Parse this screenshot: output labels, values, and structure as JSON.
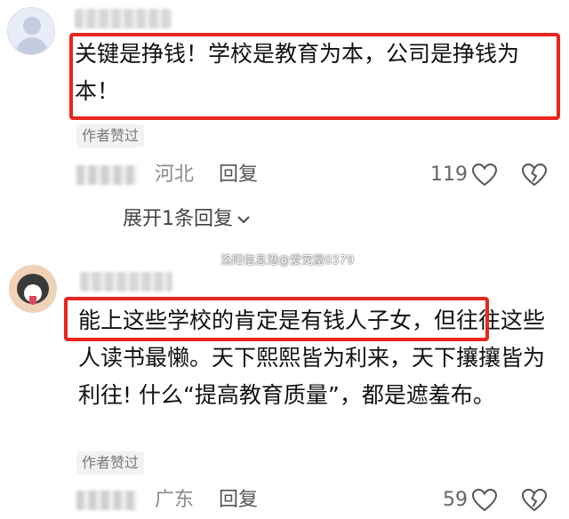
{
  "comments": [
    {
      "text": "关键是挣钱！学校是教育为本，公司是挣钱为本！",
      "author_liked_badge": "作者赞过",
      "location": "河北",
      "reply_label": "回复",
      "like_count": "119",
      "expand_replies_label": "展开1条回复"
    },
    {
      "text": "能上这些学校的肯定是有钱人子女，但往往这些人读书最懒。天下熙熙皆为利来，天下攘攘皆为利往! 什么“提高教育质量”，都是遮羞布。",
      "author_liked_badge": "作者赞过",
      "location": "广东",
      "reply_label": "回复",
      "like_count": "59"
    }
  ],
  "watermark": "洛阳信息港@爱宠屋0379",
  "colors": {
    "highlight_box": "#e8261f",
    "meta_text": "#8a8a8a",
    "badge_bg": "#f2f2f2"
  },
  "icons": [
    "default-avatar-icon",
    "dog-avatar-icon",
    "heart-icon",
    "broken-heart-icon",
    "chevron-down-icon"
  ]
}
